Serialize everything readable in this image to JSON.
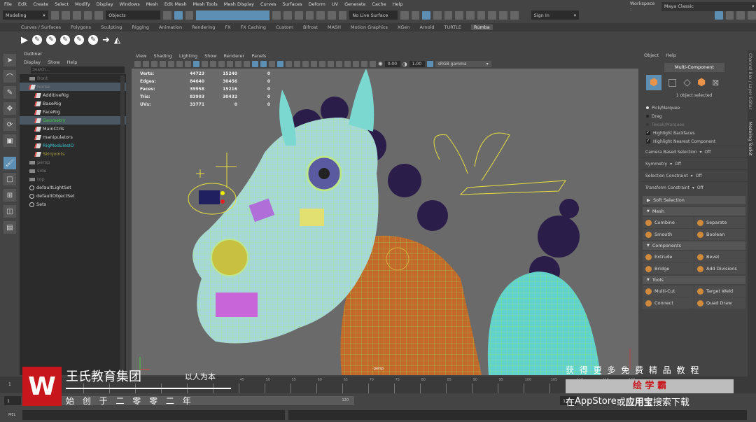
{
  "menubar": [
    "File",
    "Edit",
    "Create",
    "Select",
    "Modify",
    "Display",
    "Windows",
    "Mesh",
    "Edit Mesh",
    "Mesh Tools",
    "Mesh Display",
    "Curves",
    "Surfaces",
    "Deform",
    "UV",
    "Generate",
    "Cache",
    "Help"
  ],
  "status": {
    "mode": "Modeling",
    "objects": "Objects",
    "live_surface": "No Live Surface",
    "sign_in": "Sign In",
    "workspace_label": "Workspace :",
    "workspace": "Maya Classic"
  },
  "shelf_tabs": [
    "Curves / Surfaces",
    "Polygons",
    "Sculpting",
    "Rigging",
    "Animation",
    "Rendering",
    "FX",
    "FX Caching",
    "Custom",
    "Bifrost",
    "MASH",
    "Motion Graphics",
    "XGen",
    "Arnold",
    "TURTLE",
    "Rumba"
  ],
  "shelf_active": "Rumba",
  "outliner": {
    "title": "Outliner",
    "menu": [
      "Display",
      "Show",
      "Help"
    ],
    "search_placeholder": "Search...",
    "items": [
      {
        "label": "front",
        "type": "cam",
        "indent": 0,
        "color": "#777"
      },
      {
        "label": "horse",
        "type": "node",
        "indent": 0,
        "color": "#888",
        "selected": true
      },
      {
        "label": "AdditiveRig",
        "type": "node",
        "indent": 1,
        "color": "#ddd"
      },
      {
        "label": "BaseRig",
        "type": "node",
        "indent": 1,
        "color": "#ddd"
      },
      {
        "label": "FaceRig",
        "type": "node",
        "indent": 1,
        "color": "#ddd"
      },
      {
        "label": "Geometry",
        "type": "node",
        "indent": 1,
        "color": "#3ecb3e",
        "selected": true
      },
      {
        "label": "MainCtrls",
        "type": "node",
        "indent": 1,
        "color": "#ddd"
      },
      {
        "label": "manipulators",
        "type": "node",
        "indent": 1,
        "color": "#ddd"
      },
      {
        "label": "RigModulesIO",
        "type": "node",
        "indent": 1,
        "color": "#3cc8d8"
      },
      {
        "label": "Skinjoints",
        "type": "node",
        "indent": 1,
        "color": "#a8a040"
      },
      {
        "label": "persp",
        "type": "cam",
        "indent": 0,
        "color": "#777"
      },
      {
        "label": "side",
        "type": "cam",
        "indent": 0,
        "color": "#777"
      },
      {
        "label": "top",
        "type": "cam",
        "indent": 0,
        "color": "#777"
      },
      {
        "label": "defaultLightSet",
        "type": "set",
        "indent": 0,
        "color": "#ddd"
      },
      {
        "label": "defaultObjectSet",
        "type": "set",
        "indent": 0,
        "color": "#ddd"
      },
      {
        "label": "Sets",
        "type": "set",
        "indent": 0,
        "color": "#ddd"
      }
    ]
  },
  "viewport": {
    "menu": [
      "View",
      "Shading",
      "Lighting",
      "Show",
      "Renderer",
      "Panels"
    ],
    "exposure": "0.00",
    "gamma": "1.00",
    "color_space": "sRGB gamma",
    "camera_label": "persp",
    "stats": [
      [
        "Verts:",
        "44723",
        "15240",
        "0"
      ],
      [
        "Edges:",
        "84640",
        "30456",
        "0"
      ],
      [
        "Faces:",
        "39958",
        "15216",
        "0"
      ],
      [
        "Tris:",
        "83903",
        "30432",
        "0"
      ],
      [
        "UVs:",
        "33771",
        "0",
        "0"
      ]
    ]
  },
  "toolkit": {
    "menu": [
      "Object",
      "Help"
    ],
    "mode": "Multi-Component",
    "selected_text": "1 object selected",
    "radio": [
      {
        "label": "Pick/Marquee",
        "on": true
      },
      {
        "label": "Drag",
        "on": false
      },
      {
        "label": "Tweak/Marquee",
        "on": false,
        "disabled": true
      }
    ],
    "checks": [
      {
        "label": "Highlight Backfaces",
        "on": true
      },
      {
        "label": "Highlight Nearest Component",
        "on": true
      }
    ],
    "options": [
      {
        "label": "Camera Based Selection",
        "value": "Off"
      },
      {
        "label": "Symmetry",
        "value": "Off"
      },
      {
        "label": "Selection Constraint",
        "value": "Off"
      },
      {
        "label": "Transform Constraint",
        "value": "Off"
      }
    ],
    "soft_selection": "Soft Selection",
    "sections": [
      {
        "title": "Mesh",
        "buttons": [
          "Combine",
          "Separate",
          "Smooth",
          "Boolean"
        ]
      },
      {
        "title": "Components",
        "buttons": [
          "Extrude",
          "Bevel",
          "Bridge",
          "Add Divisions"
        ]
      },
      {
        "title": "Tools",
        "buttons": [
          "Multi-Cut",
          "Target Weld",
          "Connect",
          "Quad Draw"
        ]
      }
    ]
  },
  "vtabs": [
    "Channel Box / Layer Editor",
    "Modeling Toolkit"
  ],
  "timeline": {
    "current": "1",
    "ticks": [
      "45",
      "50",
      "55",
      "60",
      "65",
      "70",
      "75",
      "80",
      "85",
      "90",
      "95",
      "100",
      "105",
      "110",
      "115",
      "120"
    ],
    "range_start": "1",
    "range_inner_start": "1",
    "range_end": "120",
    "range_end2": "120"
  },
  "mel": {
    "label": "MEL"
  },
  "watermark": {
    "company": "王氏教育集团",
    "slogan": "以人为本",
    "founded": "始 创 于 二 零 零 二 年",
    "promo": "获 得 更 多 免 费 精 品 教 程",
    "brand": "绘 学 霸",
    "store_pre": "在",
    "store_app": "AppStore",
    "store_or": "或",
    "store_yyb": "应用宝",
    "store_post": "搜索下载"
  },
  "colors": {
    "accent": "#5d8fb5",
    "viewport_bg": "#6a6a6a",
    "brand_red": "#c8161d"
  }
}
